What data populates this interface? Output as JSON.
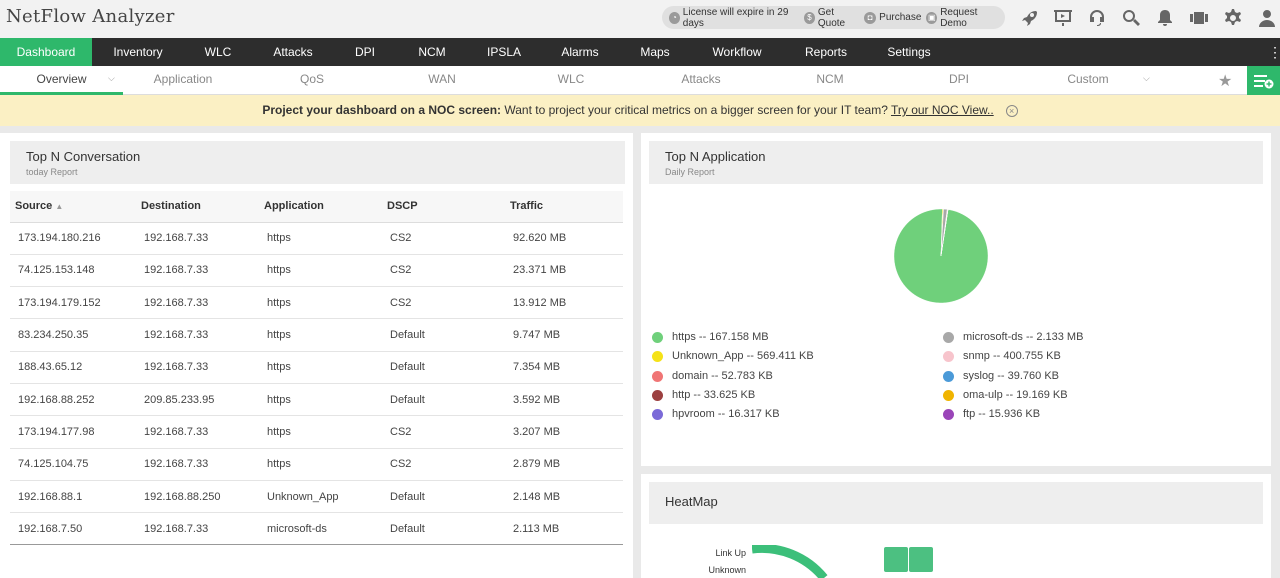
{
  "app": {
    "title": "NetFlow Analyzer"
  },
  "license": {
    "items": [
      {
        "icon": "license-icon",
        "glyph": "◔",
        "label": "License will expire in 29 days"
      },
      {
        "icon": "dollar-icon",
        "glyph": "$",
        "label": "Get Quote"
      },
      {
        "icon": "cart-icon",
        "glyph": "◘",
        "label": "Purchase"
      },
      {
        "icon": "demo-icon",
        "glyph": "▣",
        "label": "Request Demo"
      }
    ]
  },
  "top_icons": [
    "rocket-icon",
    "presentation-icon",
    "headset-icon",
    "search-icon",
    "bell-icon",
    "widgets-icon",
    "gear-icon",
    "user-icon"
  ],
  "main_nav": [
    "Dashboard",
    "Inventory",
    "WLC",
    "Attacks",
    "DPI",
    "NCM",
    "IPSLA",
    "Alarms",
    "Maps",
    "Workflow",
    "Reports",
    "Settings"
  ],
  "sub_nav": [
    "Overview",
    "Application",
    "QoS",
    "WAN",
    "WLC",
    "Attacks",
    "NCM",
    "DPI",
    "Custom"
  ],
  "banner": {
    "bold": "Project your dashboard on a NOC screen:",
    "text": " Want to project your critical metrics on a bigger screen for your IT team? ",
    "link": "Try our NOC View.."
  },
  "top_conversation": {
    "title": "Top N Conversation",
    "subtitle": "today Report",
    "columns": [
      "Source",
      "Destination",
      "Application",
      "DSCP",
      "Traffic"
    ],
    "rows": [
      [
        "173.194.180.216",
        "192.168.7.33",
        "https",
        "CS2",
        "92.620 MB"
      ],
      [
        "74.125.153.148",
        "192.168.7.33",
        "https",
        "CS2",
        "23.371 MB"
      ],
      [
        "173.194.179.152",
        "192.168.7.33",
        "https",
        "CS2",
        "13.912 MB"
      ],
      [
        "83.234.250.35",
        "192.168.7.33",
        "https",
        "Default",
        "9.747 MB"
      ],
      [
        "188.43.65.12",
        "192.168.7.33",
        "https",
        "Default",
        "7.354 MB"
      ],
      [
        "192.168.88.252",
        "209.85.233.95",
        "https",
        "Default",
        "3.592 MB"
      ],
      [
        "173.194.177.98",
        "192.168.7.33",
        "https",
        "CS2",
        "3.207 MB"
      ],
      [
        "74.125.104.75",
        "192.168.7.33",
        "https",
        "CS2",
        "2.879 MB"
      ],
      [
        "192.168.88.1",
        "192.168.88.250",
        "Unknown_App",
        "Default",
        "2.148 MB"
      ],
      [
        "192.168.7.50",
        "192.168.7.33",
        "microsoft-ds",
        "Default",
        "2.113 MB"
      ]
    ]
  },
  "top_application": {
    "title": "Top N Application",
    "subtitle": "Daily Report",
    "legend": [
      {
        "label": "https -- 167.158 MB",
        "color": "#6fd07b"
      },
      {
        "label": "Unknown_App -- 569.411 KB",
        "color": "#f5e218"
      },
      {
        "label": "domain -- 52.783 KB",
        "color": "#f07575"
      },
      {
        "label": "http -- 33.625 KB",
        "color": "#9c4040"
      },
      {
        "label": "hpvroom -- 16.317 KB",
        "color": "#7b6ad8"
      },
      {
        "label": "microsoft-ds -- 2.133 MB",
        "color": "#a8a8a8"
      },
      {
        "label": "snmp -- 400.755 KB",
        "color": "#f7c4cc"
      },
      {
        "label": "syslog -- 39.760 KB",
        "color": "#4b9ad8"
      },
      {
        "label": "oma-ulp -- 19.169 KB",
        "color": "#f0b400"
      },
      {
        "label": "ftp -- 15.936 KB",
        "color": "#9a45b8"
      }
    ]
  },
  "chart_data": {
    "type": "pie",
    "title": "Top N Application",
    "categories": [
      "https",
      "Unknown_App",
      "domain",
      "http",
      "hpvroom",
      "microsoft-ds",
      "snmp",
      "syslog",
      "oma-ulp",
      "ftp"
    ],
    "values_kb": [
      171169.8,
      569.411,
      52.783,
      33.625,
      16.317,
      2184.2,
      400.755,
      39.76,
      19.169,
      15.936
    ],
    "colors": [
      "#6fd07b",
      "#f5e218",
      "#f07575",
      "#9c4040",
      "#7b6ad8",
      "#a8a8a8",
      "#f7c4cc",
      "#4b9ad8",
      "#f0b400",
      "#9a45b8"
    ]
  },
  "heatmap": {
    "title": "HeatMap",
    "labels": [
      "Link Up",
      "Unknown"
    ]
  }
}
